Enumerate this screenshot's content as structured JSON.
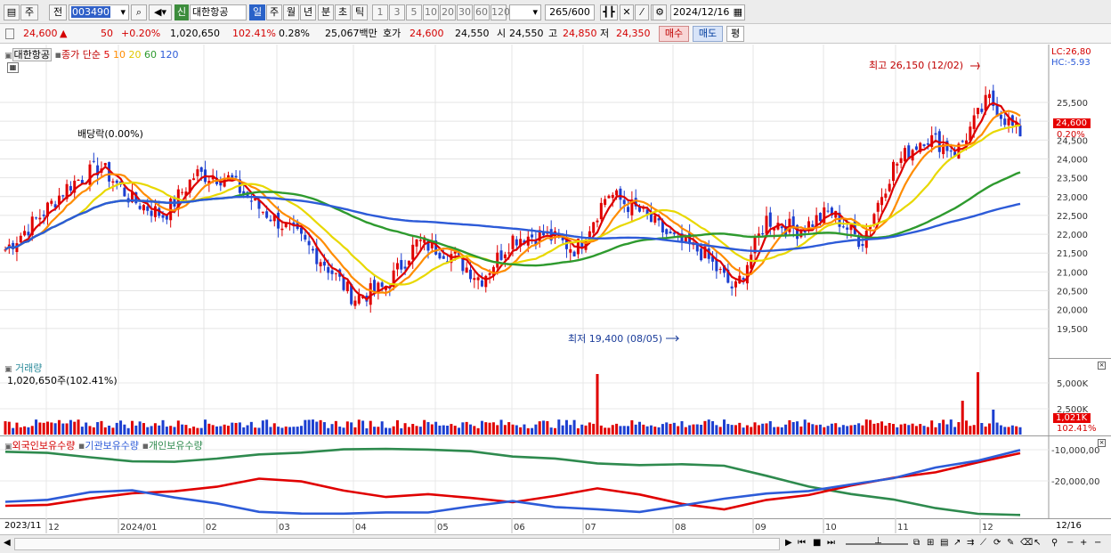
{
  "toolbar": {
    "market_type": "주",
    "prev_label": "전",
    "stock_code": "003490",
    "credit_badge": "신",
    "stock_name": "대한항공",
    "period_tabs": [
      "일",
      "주",
      "월",
      "년",
      "분",
      "초",
      "틱"
    ],
    "interval_buttons": [
      "1",
      "3",
      "5",
      "10",
      "20",
      "30",
      "60",
      "120"
    ],
    "view_count": "265",
    "view_total": "/600",
    "date": "2024/12/16"
  },
  "quote": {
    "price": "24,600",
    "change_arrow": "▲",
    "change": "50",
    "change_rate": "+0.20%",
    "volume": "1,020,650",
    "volume_ratio": "102.41%",
    "turnover": "0.28%",
    "amount": "25,067백만",
    "ask_label": "호가",
    "ask": "24,600",
    "bid": "24,550",
    "open_label": "시",
    "open": "24,550",
    "high_label": "고",
    "high": "24,850",
    "low_label": "저",
    "low": "24,350",
    "buy_button": "매수",
    "sell_button": "매도",
    "avg_button": "평"
  },
  "price_pane": {
    "legend_name": "대한항공",
    "legend_text": "종가 단순",
    "ma_periods": [
      "5",
      "10",
      "20",
      "60",
      "120"
    ],
    "ma_colors": [
      "#dd0000",
      "#ff8c00",
      "#e8d800",
      "#2e9a2e",
      "#2d5bd8"
    ],
    "lc_label": "LC:26,80",
    "hc_label": "HC:-5.93",
    "high_annotation": "최고 26,150 (12/02)",
    "low_annotation": "최저 19,400 (08/05)",
    "dividend_annotation": "배당락(0.00%)",
    "price_tag": "24,600",
    "change_tag": "0.20%"
  },
  "volume_pane": {
    "title": "거래량",
    "info": "1,020,650주(102.41%)",
    "volume_tag": "1,021K",
    "ratio_tag": "102.41%"
  },
  "holdings_pane": {
    "legend": [
      "외국인보유수량",
      "기관보유수량",
      "개인보유수량"
    ]
  },
  "x_axis": {
    "start": "2023/11",
    "end": "12/16"
  },
  "chart_data": [
    {
      "type": "candlestick",
      "title": "대한항공",
      "ylim": [
        19000,
        26800
      ],
      "y_ticks": [
        "25,500",
        "25,000",
        "24,500",
        "24,000",
        "23,500",
        "23,000",
        "22,500",
        "22,000",
        "21,500",
        "21,000",
        "20,500",
        "20,000",
        "19,500"
      ],
      "x_ticks": [
        "12",
        "2024/01",
        "02",
        "03",
        "04",
        "05",
        "06",
        "07",
        "08",
        "09",
        "10",
        "11",
        "12"
      ],
      "close_approx": [
        21600,
        22400,
        23300,
        23800,
        22900,
        22500,
        23600,
        23500,
        22700,
        22100,
        21300,
        20300,
        20600,
        21800,
        21500,
        20800,
        21900,
        22000,
        21600,
        23100,
        22600,
        21900,
        21500,
        20500,
        22400,
        22100,
        22600,
        21800,
        23800,
        24600,
        24200,
        25600,
        24600
      ],
      "series": [
        {
          "name": "5"
        },
        {
          "name": "10"
        },
        {
          "name": "20"
        },
        {
          "name": "60"
        },
        {
          "name": "120"
        }
      ],
      "annotations": [
        "최고 26,150 (12/02)",
        "최저 19,400 (08/05)",
        "배당락(0.00%)"
      ]
    },
    {
      "type": "bar",
      "title": "거래량",
      "y_ticks": [
        "5,000K",
        "2,500K"
      ],
      "last_value": "1,021K"
    },
    {
      "type": "line",
      "y_ticks": [
        "-10,000,00",
        "-20,000,00"
      ],
      "series": [
        {
          "name": "외국인보유수량"
        },
        {
          "name": "기관보유수량"
        },
        {
          "name": "개인보유수량"
        }
      ]
    }
  ]
}
